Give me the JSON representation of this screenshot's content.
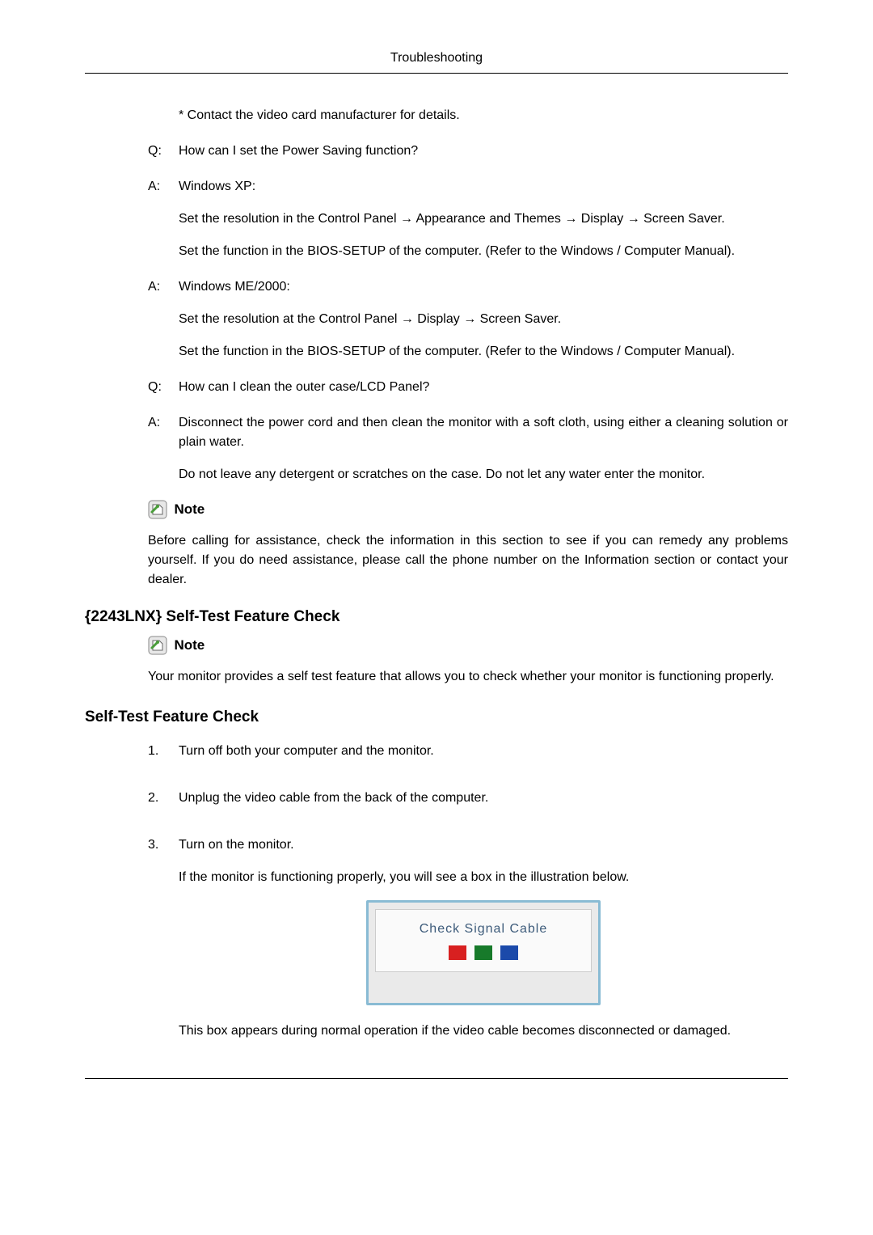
{
  "header": {
    "title": "Troubleshooting"
  },
  "body": {
    "contact_note": "* Contact the video card manufacturer for details.",
    "qa1": {
      "q_label": "Q:",
      "q_text": "How can I set the Power Saving function?",
      "a1_label": "A:",
      "a1_p1": "Windows XP:",
      "a1_p2": "Set the resolution in the Control Panel → Appearance and Themes → Display → Screen Saver.",
      "a1_p3": "Set the function in the BIOS-SETUP of the computer. (Refer to the Windows / Computer Manual).",
      "a2_label": "A:",
      "a2_p1": "Windows ME/2000:",
      "a2_p2": "Set the resolution at the Control Panel → Display → Screen Saver.",
      "a2_p3": "Set the function in the BIOS-SETUP of the computer. (Refer to the Windows / Computer Manual)."
    },
    "qa2": {
      "q_label": "Q:",
      "q_text": "How can I clean the outer case/LCD Panel?",
      "a_label": "A:",
      "a_p1": "Disconnect the power cord and then clean the monitor with a soft cloth, using either a cleaning solution or plain water.",
      "a_p2": "Do not leave any detergent or scratches on the case. Do not let any water enter the monitor."
    },
    "note1": {
      "label": "Note",
      "text": "Before calling for assistance, check the information in this section to see if you can remedy any problems yourself. If you do need assistance, please call the phone number on the Information section or contact your dealer."
    },
    "heading1": "{2243LNX} Self-Test Feature Check",
    "note2": {
      "label": "Note",
      "text": "Your monitor provides a self test feature that allows you to check whether your monitor is functioning properly."
    },
    "heading2": "Self-Test Feature Check",
    "steps": {
      "s1_num": "1.",
      "s1_text": "Turn off both your computer and the monitor.",
      "s2_num": "2.",
      "s2_text": "Unplug the video cable from the back of the computer.",
      "s3_num": "3.",
      "s3_text": "Turn on the monitor.",
      "s3_p2": "If the monitor is functioning properly, you will see a box in the illustration below.",
      "signal_text": "Check Signal Cable",
      "s3_p3": "This box appears during normal operation if the video cable becomes disconnected or damaged."
    }
  }
}
